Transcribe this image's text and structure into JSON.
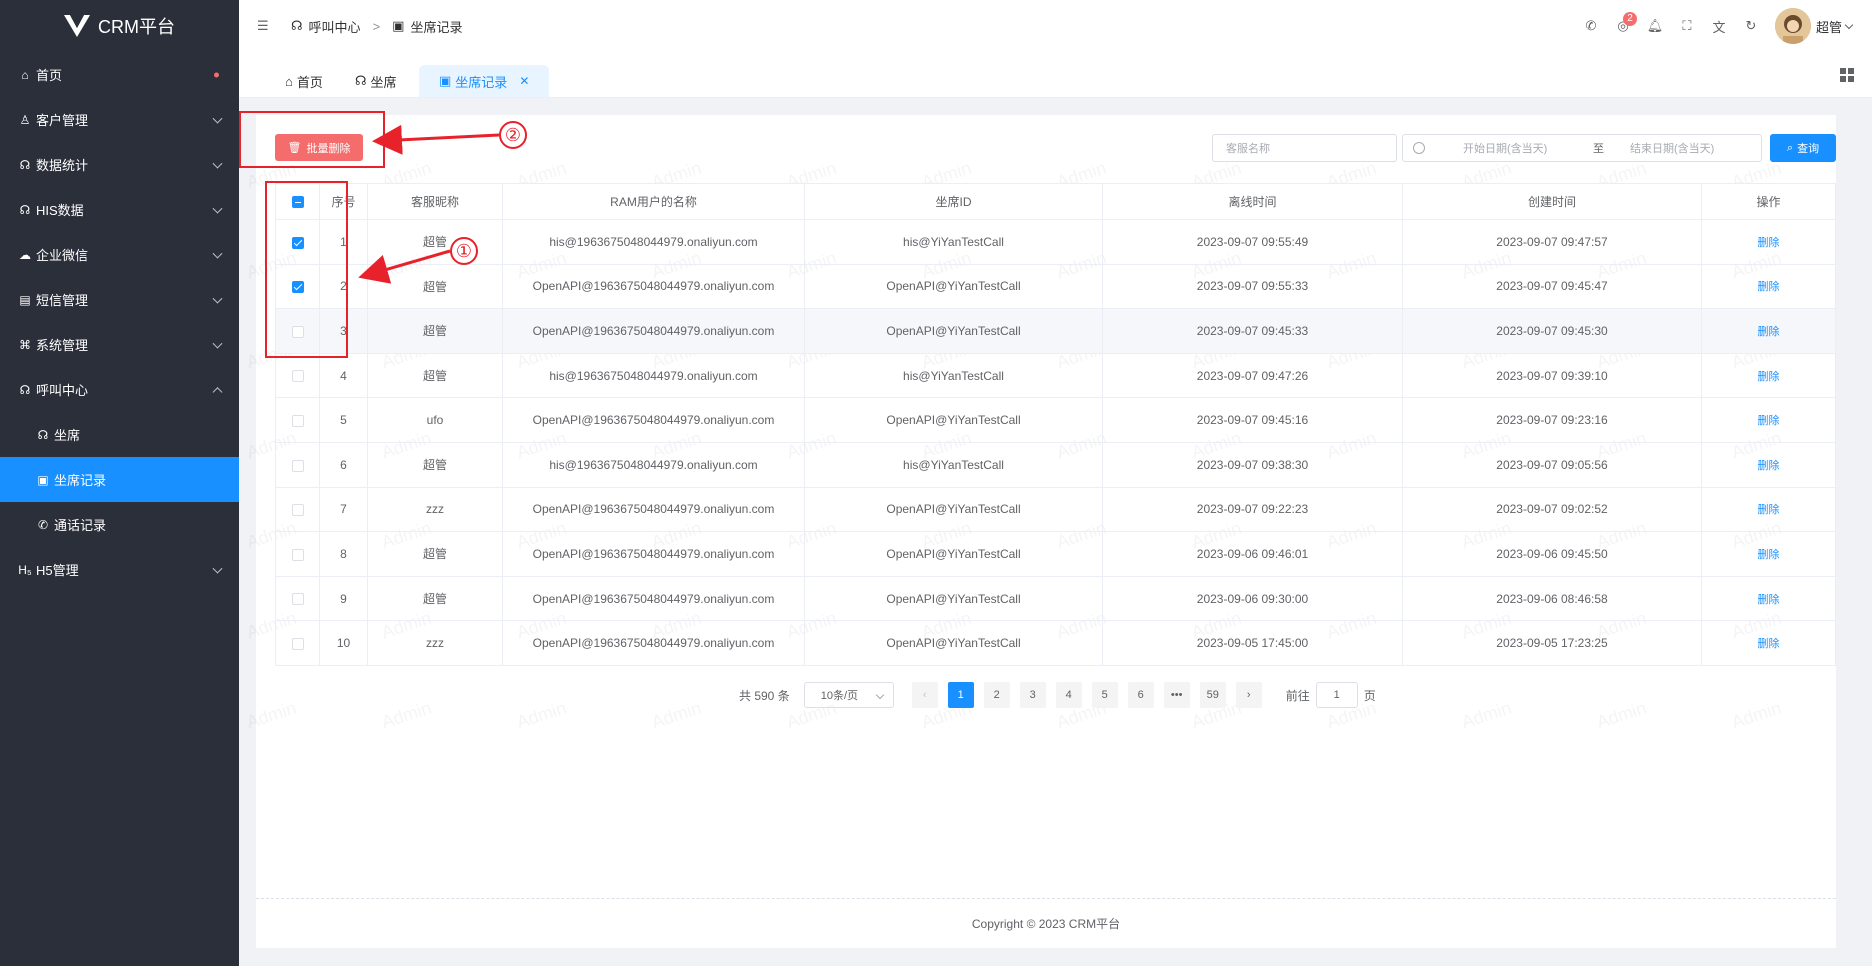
{
  "app": {
    "title": "CRM平台",
    "watermark": "Admin"
  },
  "sidebar": {
    "items": [
      {
        "label": "首页",
        "icon": "home-icon",
        "glyph": "⌂",
        "dot": true
      },
      {
        "label": "客户管理",
        "icon": "user-icon",
        "glyph": "♙",
        "chevron": "down"
      },
      {
        "label": "数据统计",
        "icon": "headset-icon",
        "glyph": "☊",
        "chevron": "down"
      },
      {
        "label": "HIS数据",
        "icon": "headset-icon",
        "glyph": "☊",
        "chevron": "down"
      },
      {
        "label": "企业微信",
        "icon": "wechat-icon",
        "glyph": "☁",
        "chevron": "down"
      },
      {
        "label": "短信管理",
        "icon": "message-icon",
        "glyph": "▤",
        "chevron": "down"
      },
      {
        "label": "系统管理",
        "icon": "command-icon",
        "glyph": "⌘",
        "chevron": "down"
      },
      {
        "label": "呼叫中心",
        "icon": "headset-icon",
        "glyph": "☊",
        "chevron": "up"
      },
      {
        "label": "坐席",
        "icon": "headset-icon",
        "glyph": "☊",
        "sub": true
      },
      {
        "label": "坐席记录",
        "icon": "clipboard-icon",
        "glyph": "▣",
        "sub": true,
        "active": true
      },
      {
        "label": "通话记录",
        "icon": "phone-icon",
        "glyph": "✆",
        "sub": true
      },
      {
        "label": "H5管理",
        "icon": "h5-icon",
        "glyph": "H₅",
        "chevron": "down"
      }
    ]
  },
  "header": {
    "breadcrumb": [
      "呼叫中心",
      "坐席记录"
    ],
    "separator": ">",
    "notification_count": "2",
    "username": "超管"
  },
  "tabs": [
    {
      "label": "首页"
    },
    {
      "label": "坐席"
    },
    {
      "label": "坐席记录",
      "active": true
    }
  ],
  "toolbar": {
    "batch_delete": "批量删除",
    "search_placeholder": "客服名称",
    "start_placeholder": "开始日期(含当天)",
    "range_sep": "至",
    "end_placeholder": "结束日期(含当天)",
    "query": "查询"
  },
  "table": {
    "columns": [
      "序号",
      "客服昵称",
      "RAM用户的名称",
      "坐席ID",
      "离线时间",
      "创建时间",
      "操作"
    ],
    "action_label": "删除",
    "rows": [
      {
        "checked": true,
        "index": "1",
        "nickname": "超管",
        "ram": "his@1963675048044979.onaliyun.com",
        "seat": "his@YiYanTestCall",
        "offline": "2023-09-07 09:55:49",
        "created": "2023-09-07 09:47:57"
      },
      {
        "checked": true,
        "index": "2",
        "nickname": "超管",
        "ram": "OpenAPI@1963675048044979.onaliyun.com",
        "seat": "OpenAPI@YiYanTestCall",
        "offline": "2023-09-07 09:55:33",
        "created": "2023-09-07 09:45:47"
      },
      {
        "checked": false,
        "index": "3",
        "nickname": "超管",
        "ram": "OpenAPI@1963675048044979.onaliyun.com",
        "seat": "OpenAPI@YiYanTestCall",
        "offline": "2023-09-07 09:45:33",
        "created": "2023-09-07 09:45:30",
        "highlight": true
      },
      {
        "checked": false,
        "index": "4",
        "nickname": "超管",
        "ram": "his@1963675048044979.onaliyun.com",
        "seat": "his@YiYanTestCall",
        "offline": "2023-09-07 09:47:26",
        "created": "2023-09-07 09:39:10"
      },
      {
        "checked": false,
        "index": "5",
        "nickname": "ufo",
        "ram": "OpenAPI@1963675048044979.onaliyun.com",
        "seat": "OpenAPI@YiYanTestCall",
        "offline": "2023-09-07 09:45:16",
        "created": "2023-09-07 09:23:16"
      },
      {
        "checked": false,
        "index": "6",
        "nickname": "超管",
        "ram": "his@1963675048044979.onaliyun.com",
        "seat": "his@YiYanTestCall",
        "offline": "2023-09-07 09:38:30",
        "created": "2023-09-07 09:05:56"
      },
      {
        "checked": false,
        "index": "7",
        "nickname": "zzz",
        "ram": "OpenAPI@1963675048044979.onaliyun.com",
        "seat": "OpenAPI@YiYanTestCall",
        "offline": "2023-09-07 09:22:23",
        "created": "2023-09-07 09:02:52"
      },
      {
        "checked": false,
        "index": "8",
        "nickname": "超管",
        "ram": "OpenAPI@1963675048044979.onaliyun.com",
        "seat": "OpenAPI@YiYanTestCall",
        "offline": "2023-09-06 09:46:01",
        "created": "2023-09-06 09:45:50"
      },
      {
        "checked": false,
        "index": "9",
        "nickname": "超管",
        "ram": "OpenAPI@1963675048044979.onaliyun.com",
        "seat": "OpenAPI@YiYanTestCall",
        "offline": "2023-09-06 09:30:00",
        "created": "2023-09-06 08:46:58"
      },
      {
        "checked": false,
        "index": "10",
        "nickname": "zzz",
        "ram": "OpenAPI@1963675048044979.onaliyun.com",
        "seat": "OpenAPI@YiYanTestCall",
        "offline": "2023-09-05 17:45:00",
        "created": "2023-09-05 17:23:25"
      }
    ]
  },
  "pagination": {
    "total": "共 590 条",
    "page_size": "10条/页",
    "pages": [
      "1",
      "2",
      "3",
      "4",
      "5",
      "6",
      "•••",
      "59"
    ],
    "current": "1",
    "goto_label": "前往",
    "goto_value": "1",
    "page_suffix": "页"
  },
  "footer": {
    "text": "Copyright ©  2023 CRM平台"
  },
  "annotations": {
    "one": "①",
    "two": "②",
    "color": "#e8222a"
  },
  "colors": {
    "sidebar_bg": "#2b2f3a",
    "accent": "#1890ff",
    "danger": "#f56c6c"
  }
}
